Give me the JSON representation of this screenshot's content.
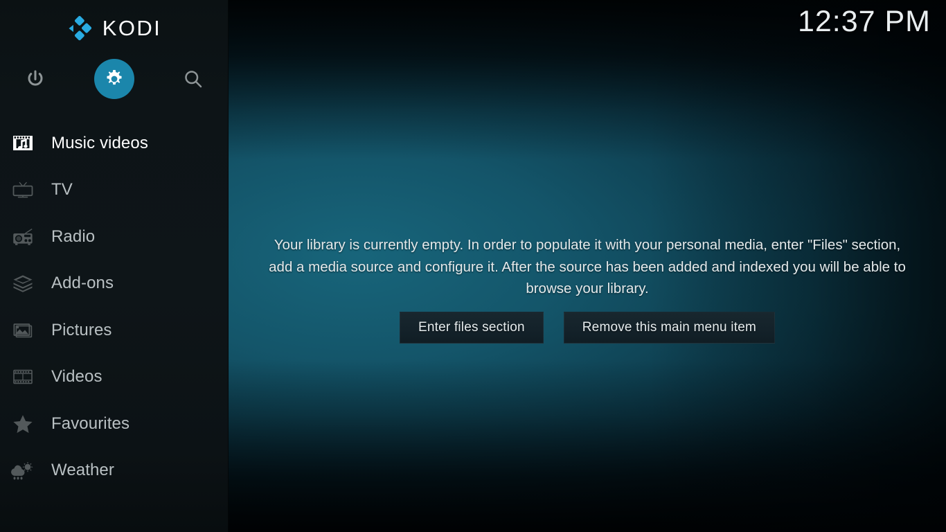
{
  "app": {
    "name": "KODI",
    "logo_color": "#29abe2"
  },
  "header": {
    "clock": "12:37 PM"
  },
  "top_icons": [
    {
      "name": "power-icon",
      "label": "Power",
      "active": false
    },
    {
      "name": "gear-icon",
      "label": "Settings",
      "active": true,
      "active_color": "#1b86ab"
    },
    {
      "name": "search-icon",
      "label": "Search",
      "active": false
    }
  ],
  "sidebar": {
    "items": [
      {
        "label": "Music videos",
        "icon": "music-video-icon",
        "selected": true
      },
      {
        "label": "TV",
        "icon": "tv-icon",
        "selected": false
      },
      {
        "label": "Radio",
        "icon": "radio-icon",
        "selected": false
      },
      {
        "label": "Add-ons",
        "icon": "addons-icon",
        "selected": false
      },
      {
        "label": "Pictures",
        "icon": "pictures-icon",
        "selected": false
      },
      {
        "label": "Videos",
        "icon": "videos-icon",
        "selected": false
      },
      {
        "label": "Favourites",
        "icon": "star-icon",
        "selected": false
      },
      {
        "label": "Weather",
        "icon": "weather-icon",
        "selected": false
      }
    ]
  },
  "main": {
    "empty_message": "Your library is currently empty. In order to populate it with your personal media, enter \"Files\" section, add a media source and configure it. After the source has been added and indexed you will be able to browse your library.",
    "buttons": [
      {
        "label": "Enter files section"
      },
      {
        "label": "Remove this main menu item"
      }
    ]
  },
  "colors": {
    "accent": "#1b86ab",
    "logo_blue": "#29abe2",
    "background_teal": "#11505f",
    "sidebar_bg": "#0d1417",
    "button_bg": "#16242b"
  }
}
